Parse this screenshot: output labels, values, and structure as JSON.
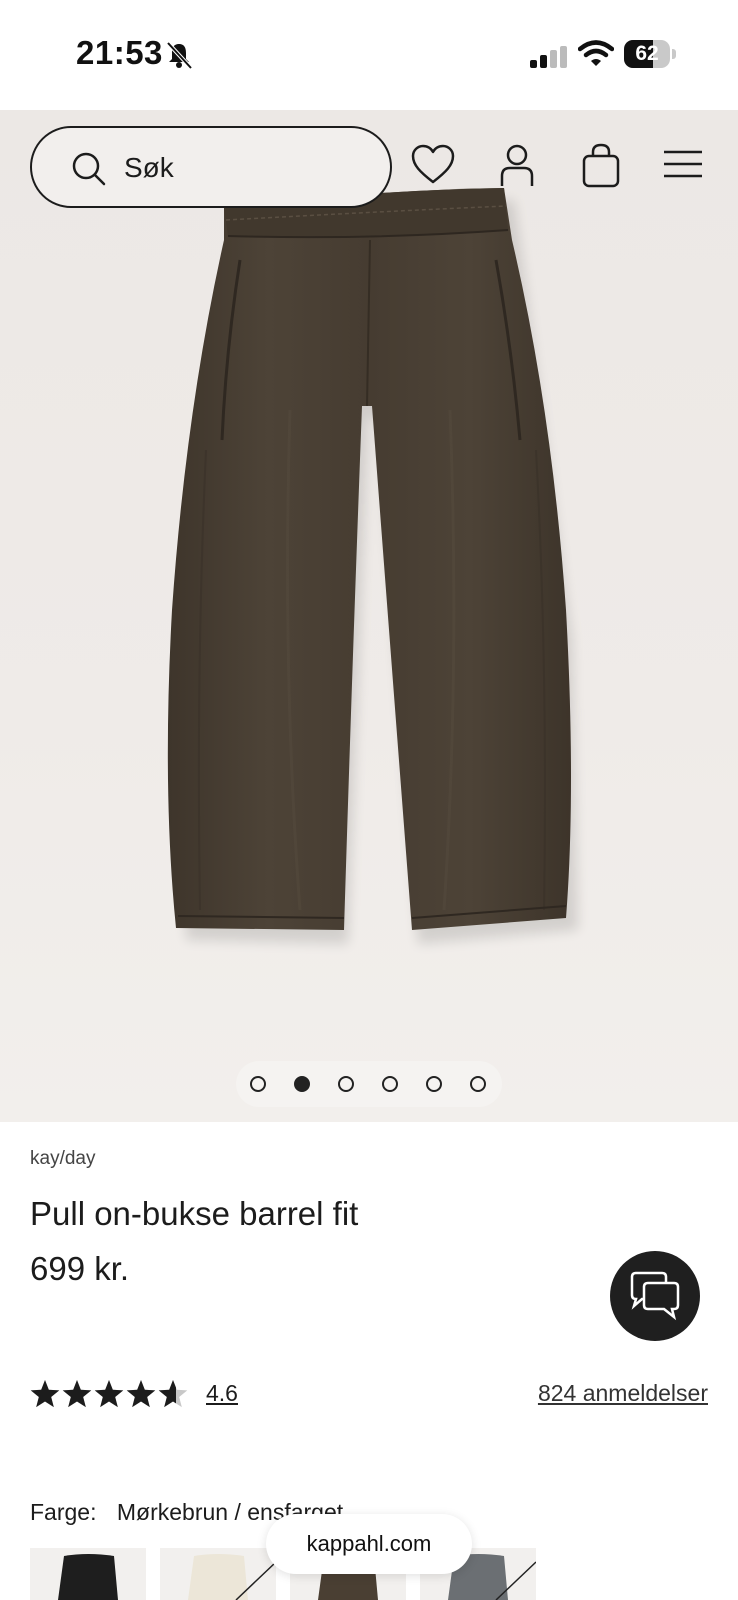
{
  "status_bar": {
    "time": "21:53",
    "battery_percent": "62",
    "battery_level": 0.62
  },
  "header": {
    "search_placeholder": "Søk"
  },
  "carousel": {
    "total_images": 6,
    "active_index": 1
  },
  "product": {
    "brand": "kay/day",
    "title": "Pull on-bukse barrel fit",
    "price": "699 kr.",
    "rating_value": "4.6",
    "rating_stars": 4.6,
    "reviews_label": "824 anmeldelser",
    "color_label": "Farge:",
    "color_value": "Mørkebrun / ensfarget"
  },
  "swatches": [
    {
      "color": "Svart",
      "hex": "#1e1e1e",
      "available": true
    },
    {
      "color": "Offwhite",
      "hex": "#ece6d8",
      "available": false
    },
    {
      "color": "Mørkebrun",
      "hex": "#4a3f33",
      "available": true
    },
    {
      "color": "Grå",
      "hex": "#6b6f73",
      "available": false
    }
  ],
  "browser": {
    "domain": "kappahl.com"
  },
  "colors": {
    "pants": "#4a4034",
    "text": "#1c1c1c",
    "hero_bg": "#ece8e5"
  }
}
